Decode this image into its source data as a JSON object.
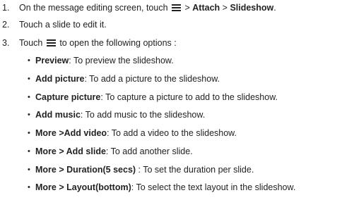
{
  "steps": [
    {
      "num": "1.",
      "pre": "On the message editing screen, touch",
      "icon": "menu-icon",
      "sep1": " > ",
      "b1": "Attach",
      "sep2": " > ",
      "b2": "Slideshow",
      "end": "."
    },
    {
      "num": "2.",
      "text": "Touch a slide to edit it."
    },
    {
      "num": "3.",
      "pre": "Touch",
      "icon": "menu-icon",
      "post": "to open the following options :"
    }
  ],
  "options": [
    {
      "bullet": "•",
      "label": "Preview",
      "desc": ": To preview the slideshow."
    },
    {
      "bullet": "•",
      "label": "Add picture",
      "desc": ": To add a picture to the slideshow."
    },
    {
      "bullet": "•",
      "label": "Capture picture",
      "desc": ": To capture a picture to add to the slideshow."
    },
    {
      "bullet": "•",
      "label": "Add music",
      "desc": ": To add music to the slideshow."
    },
    {
      "bullet": "•",
      "label": "More >Add video",
      "desc": ": To add a video to the slideshow."
    },
    {
      "bullet": "•",
      "label": "More > Add slide",
      "desc": ": To add another slide."
    },
    {
      "bullet": "•",
      "label": "More > Duration(5 secs)",
      "desc": " : To set the duration per slide."
    },
    {
      "bullet": "•",
      "label": "More > Layout(bottom)",
      "desc": ": To select the text layout in the slideshow."
    }
  ]
}
